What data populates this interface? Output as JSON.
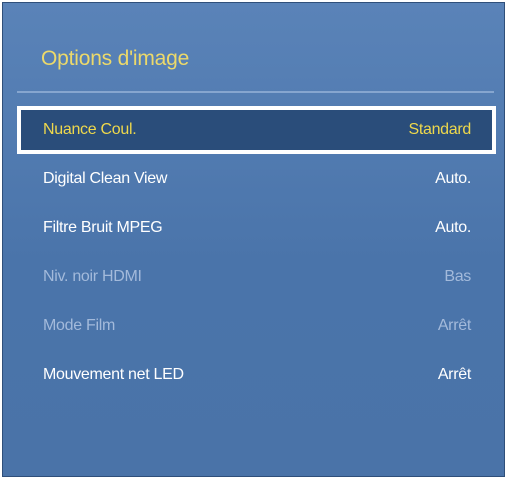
{
  "panel": {
    "title": "Options d'image"
  },
  "menu": {
    "items": [
      {
        "label": "Nuance Coul.",
        "value": "Standard",
        "selected": true,
        "enabled": true
      },
      {
        "label": "Digital Clean View",
        "value": "Auto.",
        "selected": false,
        "enabled": true
      },
      {
        "label": "Filtre Bruit MPEG",
        "value": "Auto.",
        "selected": false,
        "enabled": true
      },
      {
        "label": "Niv. noir HDMI",
        "value": "Bas",
        "selected": false,
        "enabled": false
      },
      {
        "label": "Mode Film",
        "value": "Arrêt",
        "selected": false,
        "enabled": false
      },
      {
        "label": "Mouvement net LED",
        "value": "Arrêt",
        "selected": false,
        "enabled": true
      }
    ]
  },
  "colors": {
    "background": "#4a74aa",
    "highlight_text": "#eed84c",
    "normal_text": "#ffffff",
    "disabled_text": "#a3badb",
    "selection_border": "#ffffff"
  }
}
